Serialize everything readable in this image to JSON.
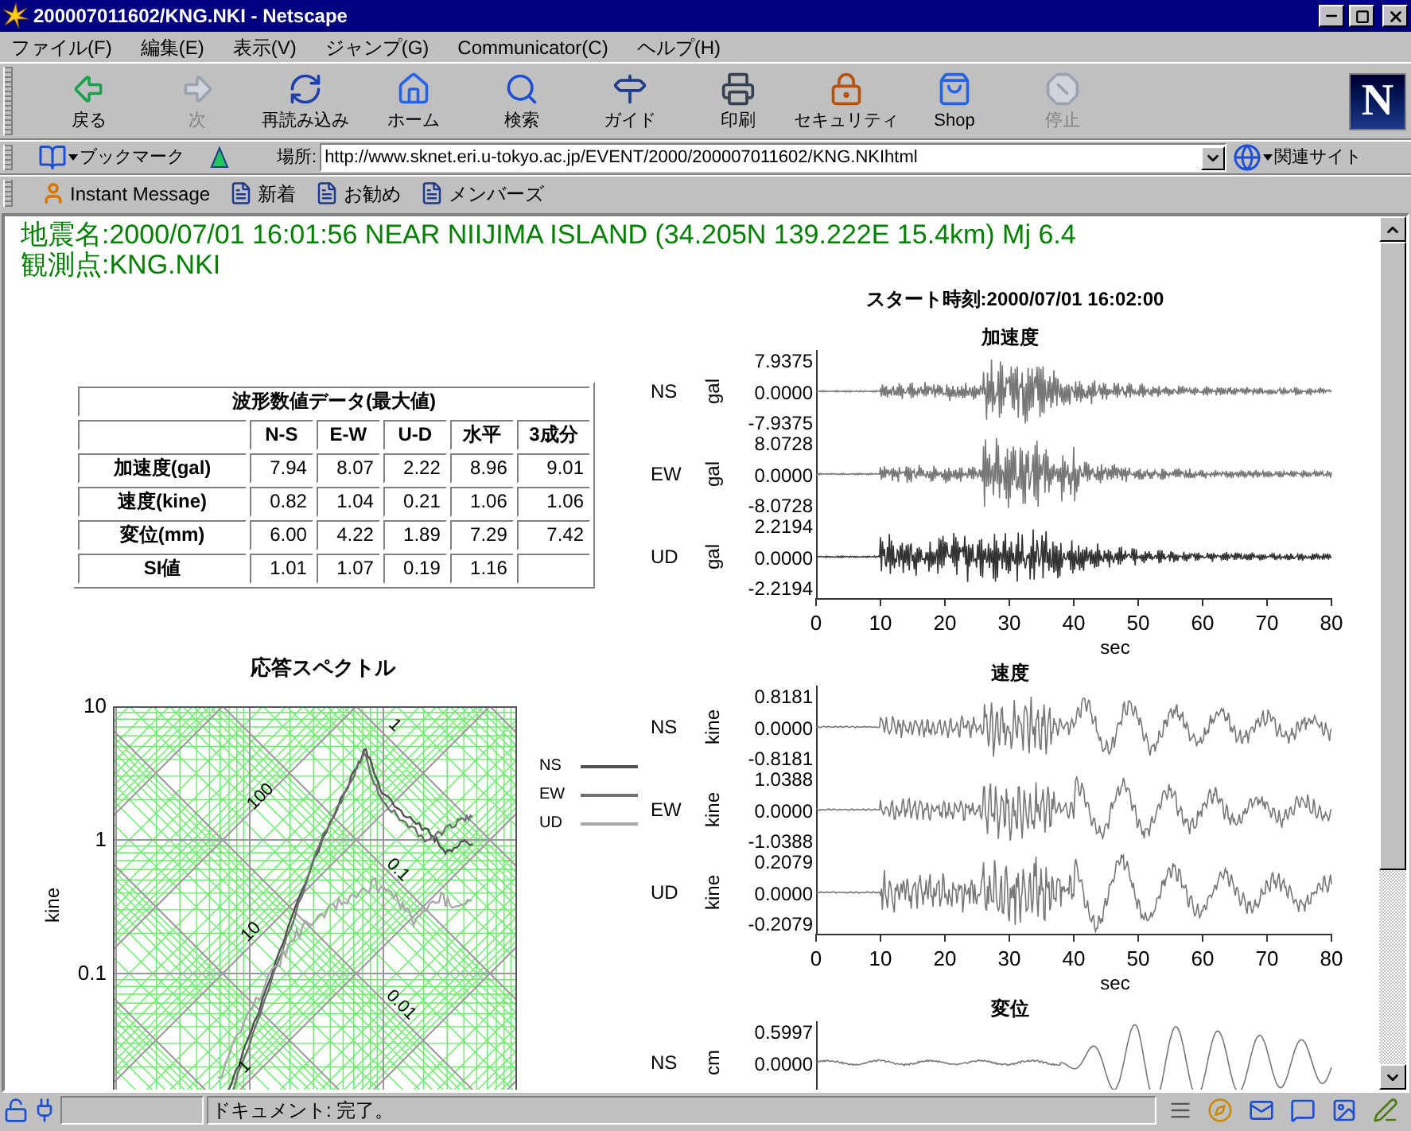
{
  "window": {
    "title": "200007011602/KNG.NKI - Netscape"
  },
  "menu": [
    "ファイル(F)",
    "編集(E)",
    "表示(V)",
    "ジャンプ(G)",
    "Communicator(C)",
    "ヘルプ(H)"
  ],
  "toolbar": [
    {
      "kind": "back",
      "label": "戻る",
      "disabled": false
    },
    {
      "kind": "forward",
      "label": "次",
      "disabled": true
    },
    {
      "kind": "reload",
      "label": "再読み込み",
      "disabled": false
    },
    {
      "kind": "home",
      "label": "ホーム",
      "disabled": false
    },
    {
      "kind": "search",
      "label": "検索",
      "disabled": false
    },
    {
      "kind": "guide",
      "label": "ガイド",
      "disabled": false
    },
    {
      "kind": "print",
      "label": "印刷",
      "disabled": false
    },
    {
      "kind": "security",
      "label": "セキュリティ",
      "disabled": false
    },
    {
      "kind": "shop",
      "label": "Shop",
      "disabled": false
    },
    {
      "kind": "stop",
      "label": "停止",
      "disabled": true
    }
  ],
  "logo": "N",
  "location_bar": {
    "bookmarks": "ブックマーク",
    "label": "場所:",
    "url": "http://www.sknet.eri.u-tokyo.ac.jp/EVENT/2000/200007011602/KNG.NKIhtml",
    "related": "関連サイト"
  },
  "personal_toolbar": [
    {
      "kind": "person",
      "label": "Instant Message"
    },
    {
      "kind": "page",
      "label": "新着"
    },
    {
      "kind": "page",
      "label": "お勧め"
    },
    {
      "kind": "page",
      "label": "メンバーズ"
    }
  ],
  "page": {
    "heading": [
      "地震名:2000/07/01 16:01:56 NEAR NIIJIMA ISLAND (34.205N 139.222E 15.4km) Mj 6.4",
      "観測点:KNG.NKI"
    ],
    "table": {
      "title": "波形数値データ(最大値)",
      "columns": [
        "N-S",
        "E-W",
        "U-D",
        "水平",
        "3成分"
      ],
      "rows": [
        {
          "label": "加速度(gal)",
          "cells": [
            "7.94",
            "8.07",
            "2.22",
            "8.96",
            "9.01"
          ]
        },
        {
          "label": "速度(kine)",
          "cells": [
            "0.82",
            "1.04",
            "0.21",
            "1.06",
            "1.06"
          ]
        },
        {
          "label": "変位(mm)",
          "cells": [
            "6.00",
            "4.22",
            "1.89",
            "7.29",
            "7.42"
          ]
        },
        {
          "label": "SI値",
          "cells": [
            "1.01",
            "1.07",
            "0.19",
            "1.16"
          ]
        }
      ]
    },
    "spectrum": {
      "title": "応答スペクトル",
      "ylabel": "kine",
      "yticks": [
        "10",
        "1",
        "0.1"
      ],
      "displacement_labels": [
        "100",
        "10",
        "1"
      ],
      "acceleration_labels": [
        "1",
        "0.1",
        "0.01"
      ],
      "legend": [
        {
          "name": "NS",
          "color": "#505050"
        },
        {
          "name": "EW",
          "color": "#707070"
        },
        {
          "name": "UD",
          "color": "#a8a8a8"
        }
      ]
    },
    "waveforms": {
      "start_time": "スタート時刻:2000/07/01 16:02:00",
      "groups": [
        {
          "kind": "acceleration",
          "title": "加速度",
          "channels": [
            {
              "name": "NS",
              "unit": "gal",
              "ticks": [
                "7.9375",
                "0.0000",
                "-7.9375"
              ]
            },
            {
              "name": "EW",
              "unit": "gal",
              "ticks": [
                "8.0728",
                "0.0000",
                "-8.0728"
              ]
            },
            {
              "name": "UD",
              "unit": "gal",
              "ticks": [
                "2.2194",
                "0.0000",
                "-2.2194"
              ]
            }
          ],
          "xticks": [
            "0",
            "10",
            "20",
            "30",
            "40",
            "50",
            "60",
            "70",
            "80"
          ],
          "xlabel": "sec"
        },
        {
          "kind": "velocity",
          "title": "速度",
          "channels": [
            {
              "name": "NS",
              "unit": "kine",
              "ticks": [
                "0.8181",
                "0.0000",
                "-0.8181"
              ]
            },
            {
              "name": "EW",
              "unit": "kine",
              "ticks": [
                "1.0388",
                "0.0000",
                "-1.0388"
              ]
            },
            {
              "name": "UD",
              "unit": "kine",
              "ticks": [
                "0.2079",
                "0.0000",
                "-0.2079"
              ]
            }
          ],
          "xticks": [
            "0",
            "10",
            "20",
            "30",
            "40",
            "50",
            "60",
            "70",
            "80"
          ],
          "xlabel": "sec"
        },
        {
          "kind": "displacement",
          "title": "変位",
          "channels": [
            {
              "name": "NS",
              "unit": "cm",
              "ticks": [
                "0.5997",
                "0.0000"
              ]
            }
          ]
        }
      ]
    }
  },
  "status_bar": {
    "text": "ドキュメント: 完了。"
  }
}
